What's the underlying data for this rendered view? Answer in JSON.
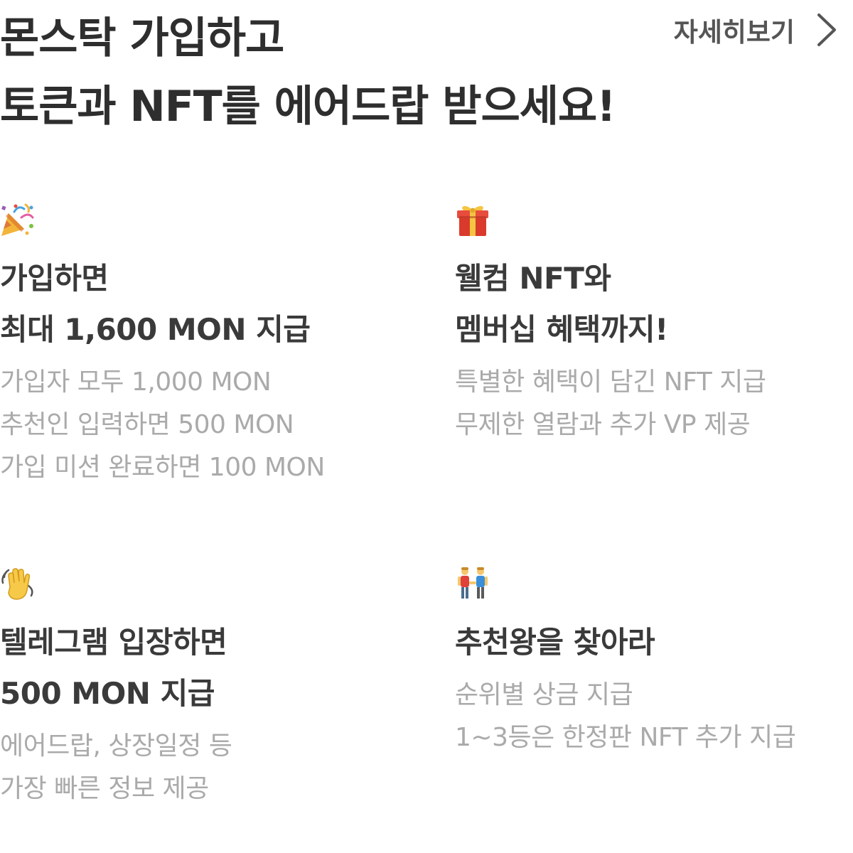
{
  "header": {
    "title_line1": "몬스탁 가입하고",
    "title_line2": "토큰과 NFT를 에어드랍 받으세요!",
    "more_label": "자세히보기",
    "more_icon": "chevron-right-icon"
  },
  "cards": [
    {
      "icon": "party-popper-icon",
      "title_lines": [
        "가입하면",
        "최대 1,600 MON 지급"
      ],
      "desc_lines": [
        "가입자 모두 1,000 MON",
        "추천인 입력하면 500 MON",
        "가입 미션 완료하면 100 MON"
      ]
    },
    {
      "icon": "gift-icon",
      "title_lines": [
        "웰컴 NFT와",
        "멤버십 혜택까지!"
      ],
      "desc_lines": [
        "특별한 혜택이 담긴 NFT 지급",
        "무제한 열람과 추가 VP 제공"
      ]
    },
    {
      "icon": "waving-hand-icon",
      "title_lines": [
        "텔레그램 입장하면",
        "500 MON 지급"
      ],
      "desc_lines": [
        "에어드랍, 상장일정 등",
        "가장 빠른 정보 제공"
      ]
    },
    {
      "icon": "two-men-holding-hands-icon",
      "title_lines": [
        "추천왕을 찾아라"
      ],
      "desc_lines": [
        "순위별 상금 지급",
        "1~3등은 한정판 NFT 추가 지급"
      ]
    }
  ],
  "colors": {
    "headline": "#2e2e2e",
    "card_title": "#3a3a3a",
    "card_desc": "#aaaaaa",
    "link": "#555555"
  }
}
